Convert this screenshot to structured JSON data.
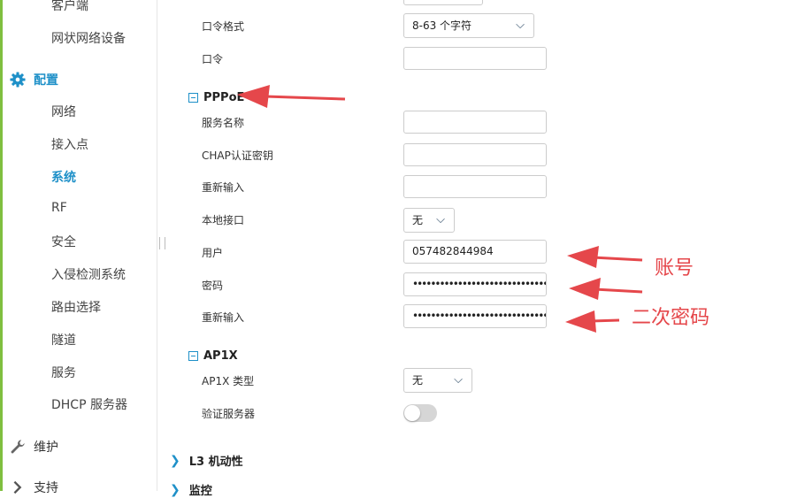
{
  "sidebar": {
    "clients_item": "客户端",
    "mesh_item": "网状网络设备",
    "config_section": "配置",
    "items": [
      "网络",
      "接入点",
      "系统",
      "RF",
      "安全",
      "入侵检测系统",
      "路由选择",
      "隧道",
      "服务",
      "DHCP 服务器"
    ],
    "active_item": "系统",
    "maintenance_section": "维护",
    "support_section": "支持"
  },
  "form": {
    "password_format_label": "口令格式",
    "password_format_value": "8-63 个字符",
    "password_label": "口令",
    "pppoe": {
      "title": "PPPoE",
      "service_name_label": "服务名称",
      "chap_secret_label": "CHAP认证密钥",
      "chap_retype_label": "重新输入",
      "local_interface_label": "本地接口",
      "local_interface_value": "无",
      "user_label": "用户",
      "user_value": "057482844984",
      "password_label": "密码",
      "password_mask": "••••••••••••••••••••••••••••••••",
      "retype_label": "重新输入",
      "retype_mask": "••••••••••••••••••••••••••••••••"
    },
    "ap1x": {
      "title": "AP1X",
      "type_label": "AP1X 类型",
      "type_value": "无",
      "auth_server_label": "验证服务器"
    },
    "l3_mobility": "L3 机动性",
    "monitoring": "监控"
  },
  "annotations": {
    "account": "账号",
    "password_twice": "二次密码",
    "color": "#e5474b"
  },
  "colors": {
    "accent": "#1e90c8",
    "left_strip": "#7fbf3f"
  }
}
